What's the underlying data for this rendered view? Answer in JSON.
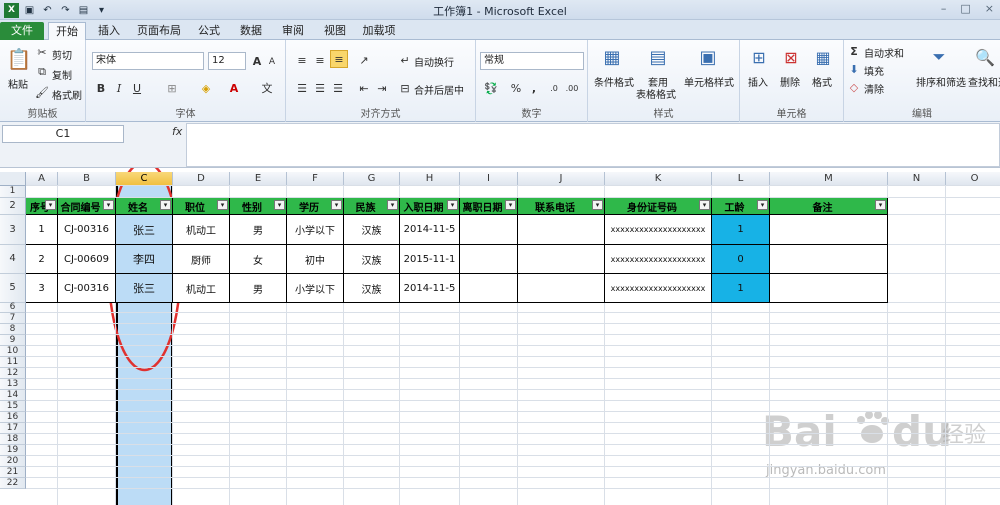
{
  "window": {
    "title": "工作簿1 - Microsoft Excel",
    "min": "–",
    "max": "□",
    "close": "×"
  },
  "tabs": [
    "文件",
    "开始",
    "插入",
    "页面布局",
    "公式",
    "数据",
    "审阅",
    "视图",
    "加载项"
  ],
  "ribbon": {
    "clipboard": {
      "paste": "粘贴",
      "cut": "剪切",
      "copy": "复制",
      "format_painter": "格式刷",
      "label": "剪贴板"
    },
    "font": {
      "name": "宋体",
      "size": "12",
      "bold": "B",
      "italic": "I",
      "underline": "U",
      "label": "字体"
    },
    "align": {
      "wrap": "自动换行",
      "merge": "合并后居中",
      "label": "对齐方式"
    },
    "number": {
      "format": "常规",
      "percent": "%",
      "comma": ",",
      "label": "数字"
    },
    "styles": {
      "conditional": "条件格式",
      "table_line1": "套用",
      "table_line2": "表格格式",
      "cell_styles": "单元格样式",
      "label": "样式"
    },
    "cells": {
      "insert": "插入",
      "delete": "删除",
      "format": "格式",
      "label": "单元格"
    },
    "editing": {
      "autosum": "自动求和",
      "fill": "填充",
      "clear": "清除",
      "sort": "排序和筛选",
      "find": "查找和选",
      "label": "编辑"
    }
  },
  "formula_bar": {
    "name_box": "C1",
    "fx": "fx",
    "formula": ""
  },
  "columns": [
    "A",
    "B",
    "C",
    "D",
    "E",
    "F",
    "G",
    "H",
    "I",
    "J",
    "K",
    "L",
    "M",
    "N",
    "O"
  ],
  "rows": [
    "1",
    "2",
    "3",
    "4",
    "5",
    "6",
    "7",
    "8",
    "9",
    "10",
    "11",
    "12",
    "13",
    "14",
    "15",
    "16",
    "17",
    "18",
    "19",
    "20",
    "21",
    "22"
  ],
  "table": {
    "headers": [
      "序号",
      "合同编号",
      "姓名",
      "职位",
      "性别",
      "学历",
      "民族",
      "入职日期",
      "离职日期",
      "联系电话",
      "身份证号码",
      "工龄",
      "备注"
    ],
    "rows": [
      [
        "1",
        "CJ-00316",
        "张三",
        "机动工",
        "男",
        "小学以下",
        "汉族",
        "2014-11-5",
        "",
        "",
        "xxxxxxxxxxxxxxxxxxxx",
        "1",
        ""
      ],
      [
        "2",
        "CJ-00609",
        "李四",
        "厨师",
        "女",
        "初中",
        "汉族",
        "2015-11-1",
        "",
        "",
        "xxxxxxxxxxxxxxxxxxxx",
        "0",
        ""
      ],
      [
        "3",
        "CJ-00316",
        "张三",
        "机动工",
        "男",
        "小学以下",
        "汉族",
        "2014-11-5",
        "",
        "",
        "xxxxxxxxxxxxxxxxxxxx",
        "1",
        ""
      ]
    ]
  },
  "colors": {
    "header_green": "#2fb84a",
    "selection_blue": "#bcdcf6",
    "highlight_cyan": "#17b2e6",
    "annotation_red": "#e0312f",
    "file_tab": "#2a8c3a"
  },
  "watermark": {
    "logo": "Bai du 经验",
    "url": "jingyan.baidu.com"
  }
}
